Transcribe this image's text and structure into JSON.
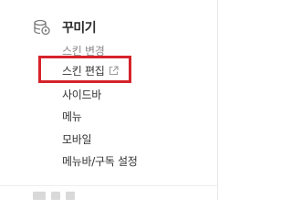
{
  "section": {
    "title": "꾸미기",
    "icon": "palette-icon"
  },
  "menu": {
    "items": [
      {
        "label": "스킨 변경"
      },
      {
        "label": "스킨 편집",
        "icon": "external-link-icon"
      },
      {
        "label": "사이드바"
      },
      {
        "label": "메뉴"
      },
      {
        "label": "모바일"
      },
      {
        "label": "메뉴바/구독 설정"
      }
    ]
  },
  "colors": {
    "highlight": "#d6232a",
    "text": "#333333",
    "title": "#2b2b2b"
  }
}
